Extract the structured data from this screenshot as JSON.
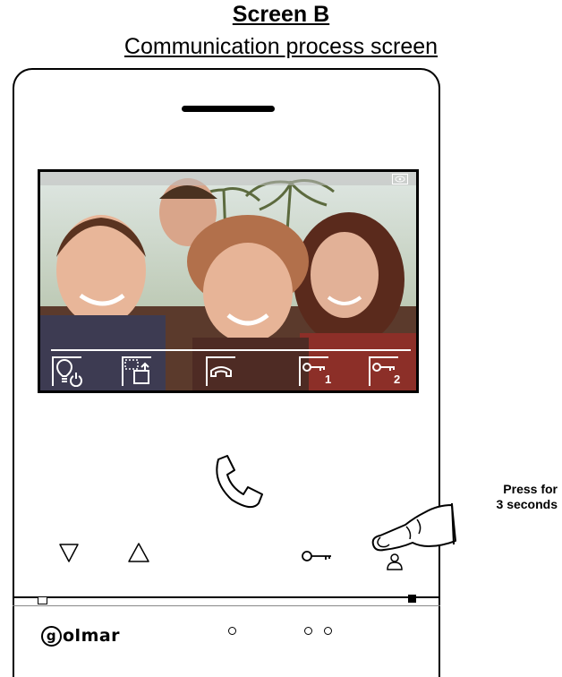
{
  "header": {
    "title": "Screen B",
    "subtitle": "Communication process screen"
  },
  "screen_icons": [
    "light-power-icon",
    "camera-switch-icon",
    "hang-up-icon",
    "door-lock-1-icon",
    "door-lock-2-icon",
    "eye-icon"
  ],
  "osd": {
    "lock1_num": "1",
    "lock2_num": "2"
  },
  "buttons": {
    "call": "handset-icon",
    "down": "down-triangle-icon",
    "up": "up-triangle-icon",
    "key": "key-icon",
    "user": "user-icon"
  },
  "instruction": {
    "line1": "Press for",
    "line2": "3 seconds"
  },
  "brand": {
    "mark": "g",
    "name": "olmar"
  },
  "colors": {
    "device_border": "#000000",
    "background": "#ffffff",
    "hand_fill": "#ffffff"
  }
}
